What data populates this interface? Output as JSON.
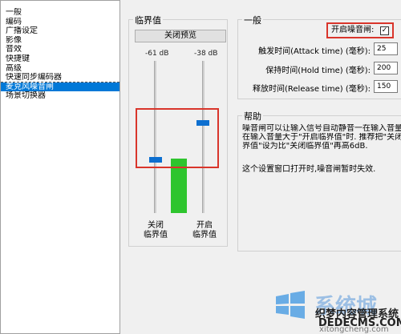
{
  "sidebar": {
    "items": [
      {
        "label": "一般"
      },
      {
        "label": "编码"
      },
      {
        "label": "广播设定"
      },
      {
        "label": "影像"
      },
      {
        "label": "音效"
      },
      {
        "label": "快捷键"
      },
      {
        "label": "高级"
      },
      {
        "label": "快速同步编码器"
      },
      {
        "label": "麦克风噪音闸"
      },
      {
        "label": "场景切换器"
      }
    ],
    "selected_index": 8
  },
  "threshold": {
    "group_title": "临界值",
    "preview_button": "关闭预览",
    "close_db": "-61 dB",
    "open_db": "-38 dB",
    "close_caption": "关闭\n临界值",
    "open_caption": "开启\n临界值",
    "level_fraction": 0.36,
    "close_thumb_fraction": 0.37,
    "open_thumb_fraction": 0.61
  },
  "general": {
    "group_title": "一般",
    "enable_label": "开启噪音闸:",
    "enable_checked": "✓",
    "attack_label": "触发时间(Attack time) (毫秒):",
    "attack_value": "25",
    "hold_label": "保持时间(Hold time) (毫秒):",
    "hold_value": "200",
    "release_label": "释放时间(Release time) (毫秒):",
    "release_value": "150"
  },
  "help": {
    "group_title": "帮助",
    "line1": "噪音闸可以让输入信号自动静音一在输入音量",
    "line2": "在输入音量大于\"开启临界值\"时. 推荐把\"关闭",
    "line3": "界值\"设为比\"关闭临界值\"再高6dB.",
    "note": "这个设置窗口打开时,噪音闸暂时失效."
  },
  "watermark": {
    "brand": "系统城",
    "text": "织梦内容管理系统",
    "url": "DEDECMS.COM",
    "url2": "xitongcheng.com"
  },
  "colors": {
    "selected_bg": "#0078d7",
    "level_green": "#2ec52e",
    "thumb_blue": "#0d6fd0",
    "highlight_red": "#d9352b"
  }
}
